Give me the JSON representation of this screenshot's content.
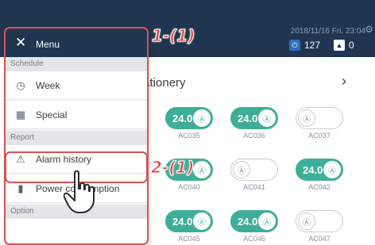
{
  "header": {
    "datetime": "2018/11/16 Fri. 23:04",
    "operating_count": "127",
    "alarm_count": "0"
  },
  "group": {
    "title": "tationery",
    "units_row1": [
      {
        "temp": "24.0",
        "name": "AC035",
        "on": true
      },
      {
        "temp": "24.0",
        "name": "AC036",
        "on": true
      },
      {
        "temp": "",
        "name": "AC037",
        "on": false
      }
    ],
    "units_row2": [
      {
        "temp": "",
        "name": "AC040",
        "on": true
      },
      {
        "temp": "",
        "name": "AC041",
        "on": false
      },
      {
        "temp": "24.0",
        "name": "AC042",
        "on": true
      }
    ],
    "units_row3": [
      {
        "temp": "24.0",
        "name": "AC045",
        "on": true
      },
      {
        "temp": "24.0",
        "name": "AC046",
        "on": true
      },
      {
        "temp": "",
        "name": "AC047",
        "on": false
      }
    ]
  },
  "menu": {
    "title": "Menu",
    "section_schedule": "Schedule",
    "item_week": "Week",
    "item_special": "Special",
    "section_report": "Report",
    "item_alarm_history": "Alarm history",
    "item_power": "Power consumption",
    "section_option": "Option"
  },
  "annotations": {
    "step1": "1-(1)",
    "step2": "2-(1)"
  },
  "colors": {
    "header_bg": "#1f3550",
    "unit_on": "#3fae98",
    "callout": "#d9534f"
  }
}
